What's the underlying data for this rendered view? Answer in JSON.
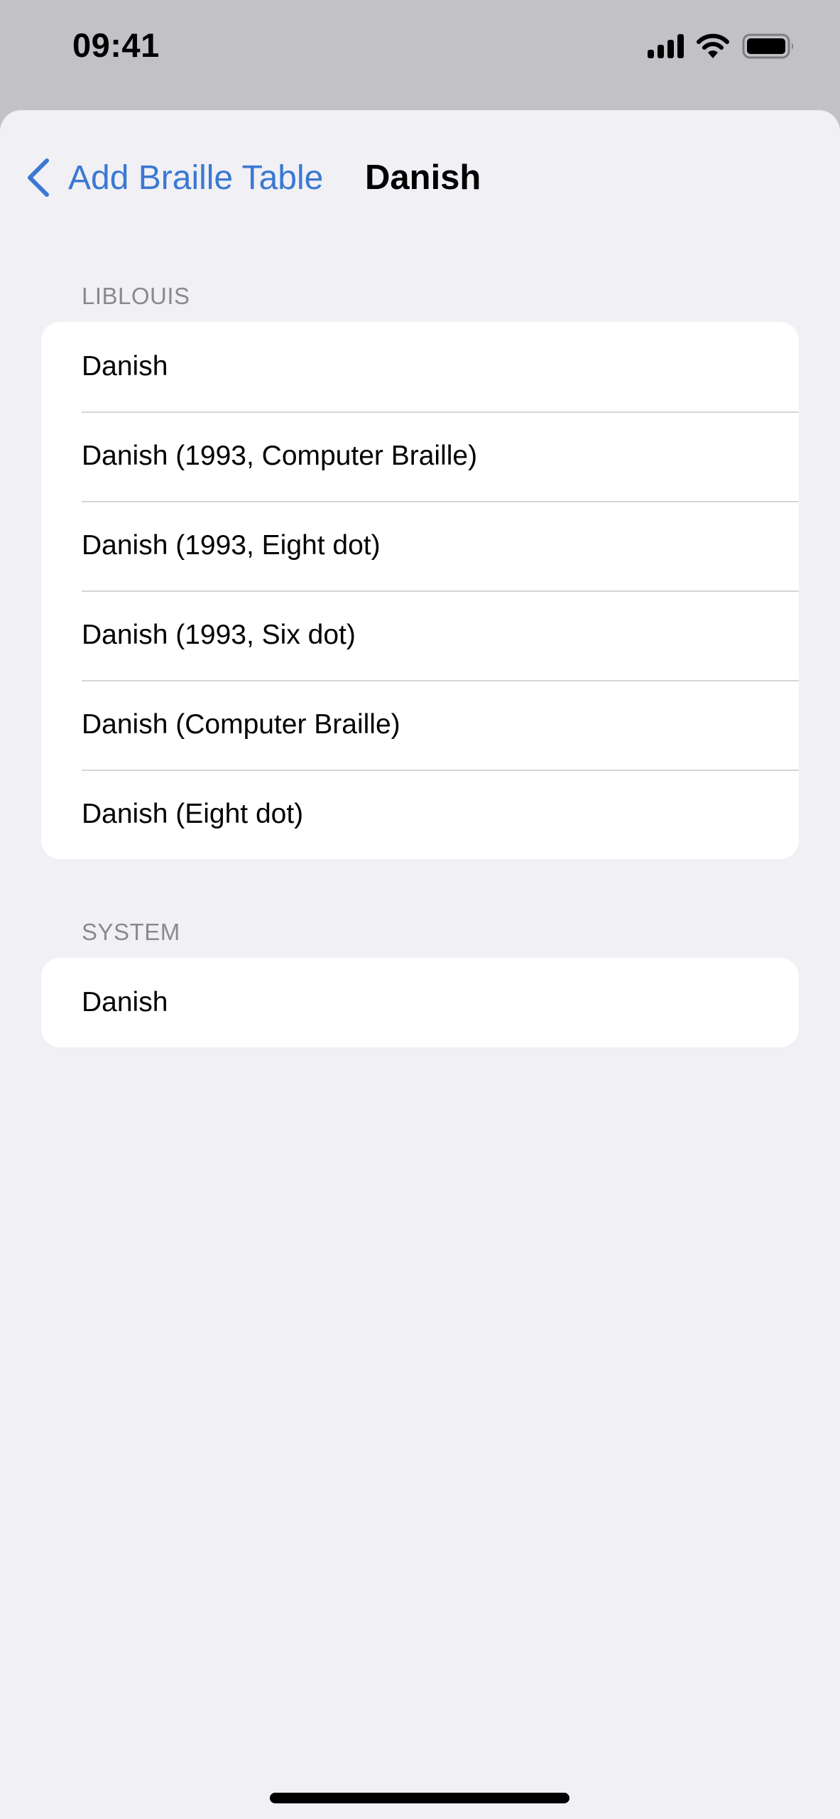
{
  "status_bar": {
    "time": "09:41",
    "icons": [
      "cellular-signal-icon",
      "wifi-icon",
      "battery-icon"
    ]
  },
  "nav": {
    "back_label": "Add Braille Table",
    "back_icon": "chevron-left-icon",
    "title": "Danish",
    "accent_color": "#3b78d2"
  },
  "sections": [
    {
      "header": "LIBLOUIS",
      "items": [
        "Danish",
        "Danish (1993, Computer Braille)",
        "Danish (1993, Eight dot)",
        "Danish (1993, Six dot)",
        "Danish (Computer Braille)",
        "Danish (Eight dot)"
      ]
    },
    {
      "header": "SYSTEM",
      "items": [
        "Danish"
      ]
    }
  ]
}
